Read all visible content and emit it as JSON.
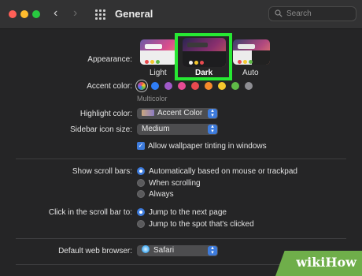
{
  "window": {
    "title": "General"
  },
  "search": {
    "placeholder": "Search"
  },
  "appearance": {
    "label": "Appearance:",
    "options": [
      "Light",
      "Dark",
      "Auto"
    ],
    "selected": "Dark",
    "highlight_color": "#27e833"
  },
  "accent": {
    "label": "Accent color:",
    "colors": [
      "multicolor",
      "#2f7ef6",
      "#a05ac8",
      "#e64b94",
      "#e84a4f",
      "#f58a2b",
      "#f5c82d",
      "#5fbb47",
      "#8e8e93"
    ],
    "selected_name": "Multicolor"
  },
  "highlight": {
    "label": "Highlight color:",
    "value": "Accent Color"
  },
  "sidebar_icon": {
    "label": "Sidebar icon size:",
    "value": "Medium"
  },
  "wallpaper_tinting": {
    "label": "Allow wallpaper tinting in windows",
    "checked": true
  },
  "scroll_bars": {
    "label": "Show scroll bars:",
    "options": [
      "Automatically based on mouse or trackpad",
      "When scrolling",
      "Always"
    ],
    "selected": 0
  },
  "scroll_click": {
    "label": "Click in the scroll bar to:",
    "options": [
      "Jump to the next page",
      "Jump to the spot that's clicked"
    ],
    "selected": 0
  },
  "browser": {
    "label": "Default web browser:",
    "value": "Safari"
  },
  "watermark": {
    "text": "wikiHow"
  },
  "colors": {
    "accent": "#3d7bdc",
    "background": "#252526"
  }
}
